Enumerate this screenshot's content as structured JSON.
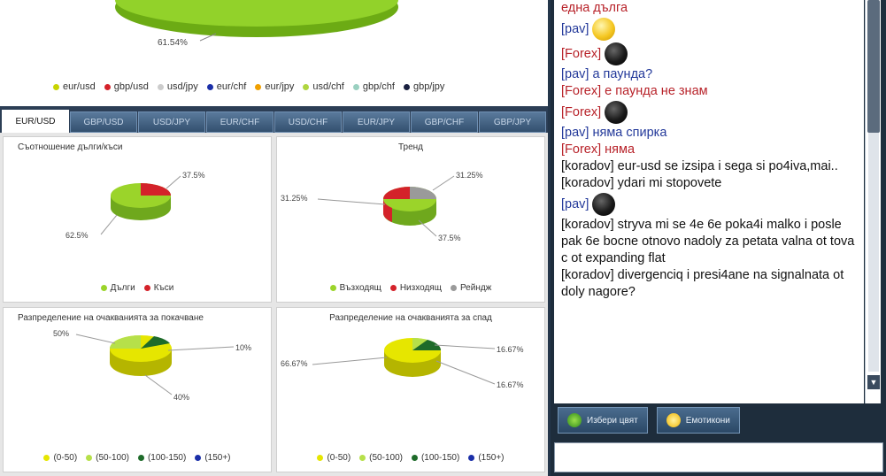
{
  "top_chart": {
    "label": "61.54%",
    "legend": [
      {
        "name": "eur/usd",
        "color": "#c8d400"
      },
      {
        "name": "gbp/usd",
        "color": "#d4222a"
      },
      {
        "name": "usd/jpy",
        "color": "#cccccc"
      },
      {
        "name": "eur/chf",
        "color": "#1b2fa8"
      },
      {
        "name": "eur/jpy",
        "color": "#f0a000"
      },
      {
        "name": "usd/chf",
        "color": "#b0d640"
      },
      {
        "name": "gbp/chf",
        "color": "#9ad0c0"
      },
      {
        "name": "gbp/jpy",
        "color": "#1a2040"
      }
    ]
  },
  "tabs": [
    "EUR/USD",
    "GBP/USD",
    "USD/JPY",
    "EUR/CHF",
    "USD/CHF",
    "EUR/JPY",
    "GBP/CHF",
    "GBP/JPY"
  ],
  "panels": {
    "p1": {
      "title": "Съотношение дълги/къси",
      "labels": [
        "37.5%",
        "62.5%"
      ],
      "legend": [
        {
          "name": "Дълги",
          "color": "#9bd42a"
        },
        {
          "name": "Къси",
          "color": "#d4222a"
        }
      ]
    },
    "p2": {
      "title": "Тренд",
      "labels": [
        "31.25%",
        "31.25%",
        "37.5%"
      ],
      "legend": [
        {
          "name": "Възходящ",
          "color": "#9bd42a"
        },
        {
          "name": "Низходящ",
          "color": "#d4222a"
        },
        {
          "name": "Рейндж",
          "color": "#9a9a9a"
        }
      ]
    },
    "p3": {
      "title": "Разпределение на очакванията за покачване",
      "labels": [
        "50%",
        "10%",
        "40%"
      ],
      "legend": [
        {
          "name": "(0-50)",
          "color": "#e6e600"
        },
        {
          "name": "(50-100)",
          "color": "#b6e04a"
        },
        {
          "name": "(100-150)",
          "color": "#1e6b2a"
        },
        {
          "name": "(150+)",
          "color": "#1b2fa8"
        }
      ]
    },
    "p4": {
      "title": "Разпределение на очакванията за спад",
      "labels": [
        "66.67%",
        "16.67%",
        "16.67%"
      ],
      "legend": [
        {
          "name": "(0-50)",
          "color": "#e6e600"
        },
        {
          "name": "(50-100)",
          "color": "#b6e04a"
        },
        {
          "name": "(100-150)",
          "color": "#1e6b2a"
        },
        {
          "name": "(150+)",
          "color": "#1b2fa8"
        }
      ]
    }
  },
  "chat": {
    "messages": [
      {
        "nick": "",
        "text": "една дълга",
        "style": "red",
        "smiley": ""
      },
      {
        "nick": "[pav]",
        "text": "",
        "style": "blue",
        "smiley": "yellow"
      },
      {
        "nick": "[Forex]",
        "text": "",
        "style": "red",
        "smiley": "black"
      },
      {
        "nick": "[pav]",
        "text": " а паунда?",
        "style": "blue",
        "smiley": ""
      },
      {
        "nick": "[Forex]",
        "text": " е паунда не знам",
        "style": "red",
        "smiley": ""
      },
      {
        "nick": "[Forex]",
        "text": "",
        "style": "red",
        "smiley": "black"
      },
      {
        "nick": "[pav]",
        "text": " няма спирка",
        "style": "blue",
        "smiley": ""
      },
      {
        "nick": "[Forex]",
        "text": " няма",
        "style": "red",
        "smiley": ""
      },
      {
        "nick": "[koradov]",
        "text": " eur-usd se izsipa i sega si po4iva,mai..",
        "style": "dark",
        "smiley": ""
      },
      {
        "nick": "[koradov]",
        "text": " ydari mi stopovete",
        "style": "dark",
        "smiley": ""
      },
      {
        "nick": "[pav]",
        "text": "",
        "style": "blue",
        "smiley": "black"
      },
      {
        "nick": "[koradov]",
        "text": " stryva mi se 4e 6e poka4i malko i posle pak 6e bocne otnovo nadoly za petata valna ot tova c ot expanding flat",
        "style": "dark",
        "smiley": ""
      },
      {
        "nick": "[koradov]",
        "text": " divergenciq i presi4ane na signalnata ot doly nagore?",
        "style": "dark",
        "smiley": ""
      }
    ],
    "buttons": [
      {
        "label": "Избери цвят",
        "icon": "palette-icon"
      },
      {
        "label": "Емотикони",
        "icon": "smiley-icon"
      }
    ]
  },
  "colors": {
    "green": "#9bd42a",
    "red": "#d4222a",
    "grey": "#9a9a9a",
    "yellow": "#e6e600",
    "lightgreen": "#b6e04a",
    "darkgreen": "#1e6b2a",
    "blue": "#1b2fa8"
  }
}
